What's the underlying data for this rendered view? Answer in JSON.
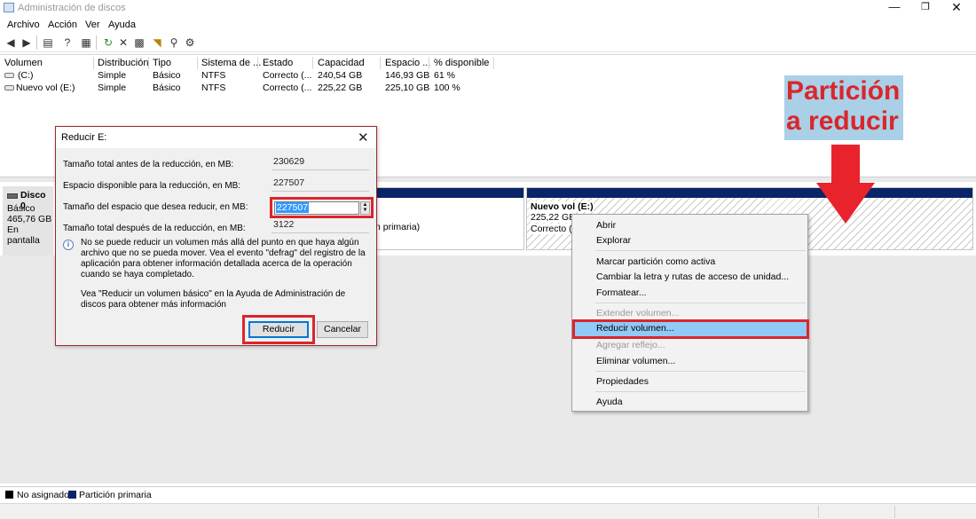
{
  "window": {
    "title": "Administración de discos",
    "minimize_glyph": "—",
    "maximize_glyph": "❐",
    "close_glyph": "✕"
  },
  "menu": [
    "Archivo",
    "Acción",
    "Ver",
    "Ayuda"
  ],
  "toolbar": {
    "icons": [
      "back-icon",
      "forward-icon",
      "console-tree-icon",
      "help-icon",
      "properties-icon",
      "refresh-icon",
      "delete-icon",
      "rescan-icon",
      "open-icon",
      "explore-icon",
      "settings-icon"
    ]
  },
  "volume_list": {
    "columns": [
      "Volumen",
      "Distribución",
      "Tipo",
      "Sistema de ...",
      "Estado",
      "Capacidad",
      "Espacio ...",
      "% disponible"
    ],
    "rows": [
      {
        "volume": "(C:)",
        "layout": "Simple",
        "type": "Básico",
        "fs": "NTFS",
        "status": "Correcto (...",
        "capacity": "240,54 GB",
        "free": "146,93 GB",
        "pct": "61 %"
      },
      {
        "volume": "Nuevo vol (E:)",
        "layout": "Simple",
        "type": "Básico",
        "fs": "NTFS",
        "status": "Correcto (...",
        "capacity": "225,22 GB",
        "free": "225,10 GB",
        "pct": "100 %"
      }
    ]
  },
  "disk": {
    "name": "Disco 0",
    "type": "Básico",
    "size": "465,76 GB",
    "status": "En pantalla",
    "partition_c_fragment": "n primaria)",
    "partition_e": {
      "name": "Nuevo vol  (E:)",
      "size": "225,22 GB",
      "status": "Correcto (P"
    }
  },
  "legend": {
    "unallocated": "No asignado",
    "primary": "Partición primaria",
    "colors": {
      "unallocated": "#000000",
      "primary": "#0a246a"
    }
  },
  "annotation": {
    "line1": "Partición",
    "line2": "a reducir",
    "text_color": "#d9262c",
    "bg_color": "#a9d0e6"
  },
  "dialog": {
    "title": "Reducir E:",
    "close_glyph": "✕",
    "total_before_label": "Tamaño total antes de la reducción, en MB:",
    "total_before_value": "230629",
    "available_label": "Espacio disponible para la reducción, en MB:",
    "available_value": "227507",
    "shrink_label": "Tamaño del espacio que desea reducir, en MB:",
    "shrink_value": "227507",
    "total_after_label": "Tamaño total después de la reducción, en MB:",
    "total_after_value": "3122",
    "info_text": "No se puede reducir un volumen más allá del punto en que haya algún archivo que no se pueda mover. Vea el evento \"defrag\" del registro de la aplicación para obtener información detallada acerca de la operación cuando se haya completado.",
    "help_text": "Vea \"Reducir un volumen básico\"  en la Ayuda de Administración de discos para obtener más información",
    "reduce_button": "Reducir",
    "cancel_button": "Cancelar"
  },
  "context_menu": {
    "items": [
      {
        "label": "Abrir",
        "enabled": true
      },
      {
        "label": "Explorar",
        "enabled": true
      },
      {
        "label": "Marcar partición como activa",
        "enabled": true
      },
      {
        "label": "Cambiar la letra y rutas de acceso de unidad...",
        "enabled": true
      },
      {
        "label": "Formatear...",
        "enabled": true
      },
      {
        "label": "Extender volumen...",
        "enabled": false
      },
      {
        "label": "Reducir volumen...",
        "enabled": true,
        "highlighted": true
      },
      {
        "label": "Agregar reflejo...",
        "enabled": false
      },
      {
        "label": "Eliminar volumen...",
        "enabled": true
      },
      {
        "label": "Propiedades",
        "enabled": true
      },
      {
        "label": "Ayuda",
        "enabled": true
      }
    ]
  }
}
